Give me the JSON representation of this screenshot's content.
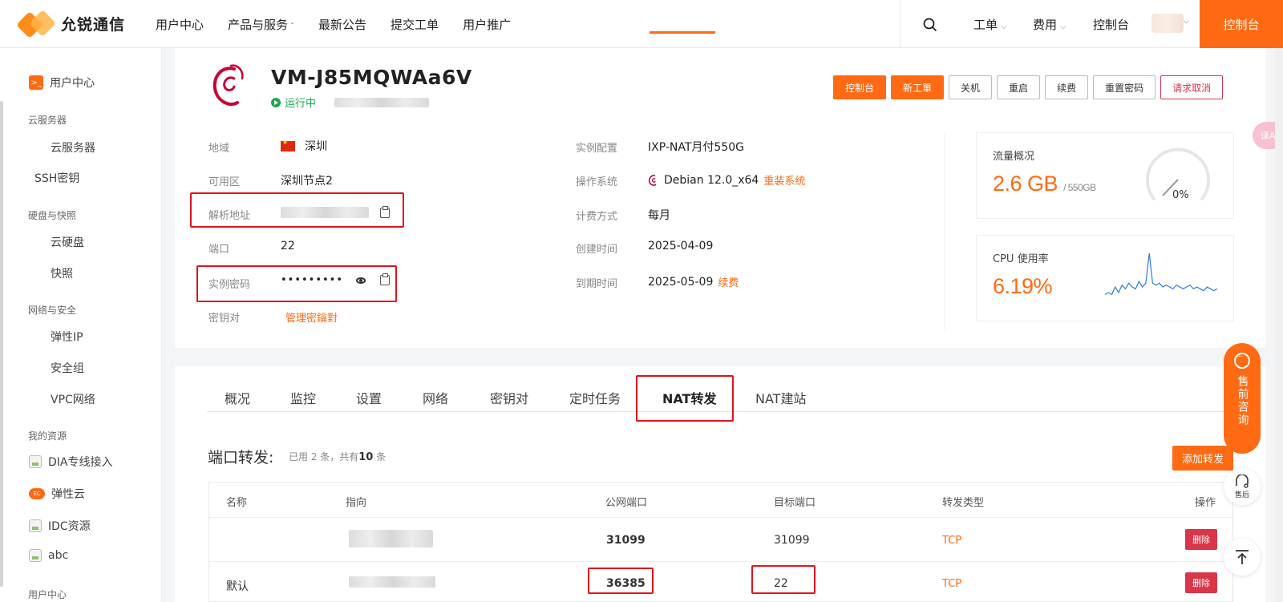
{
  "brand": {
    "name": "允锐通信"
  },
  "nav": [
    {
      "label": "用户中心"
    },
    {
      "label": "产品与服务",
      "caret": "ˇ"
    },
    {
      "label": "最新公告"
    },
    {
      "label": "提交工单"
    },
    {
      "label": "用户推广"
    }
  ],
  "header_right": {
    "ticket": "工单",
    "billing": "费用",
    "console_link": "控制台",
    "console_button": "控制台",
    "caret": "⌵"
  },
  "sidebar": {
    "user_center": "用户中心",
    "groups": [
      {
        "title": "云服务器",
        "items": [
          "云服务器",
          "SSH密钥"
        ]
      },
      {
        "title": "硬盘与快照",
        "items": [
          "云硬盘",
          "快照"
        ]
      },
      {
        "title": "网络与安全",
        "items": [
          "弹性IP",
          "安全组",
          "VPC网络"
        ]
      },
      {
        "title": "我的资源",
        "items": [
          "DIA专线接入",
          "弹性云",
          "IDC资源",
          "abc"
        ]
      },
      {
        "title": "用户中心",
        "items": []
      }
    ]
  },
  "instance": {
    "name": "VM-J85MQWAa6V",
    "status": "运行中",
    "actions": [
      "控制台",
      "新工單",
      "关机",
      "重启",
      "续费",
      "重置密码",
      "请求取消"
    ]
  },
  "info_left": [
    {
      "label": "地域",
      "value": "深圳"
    },
    {
      "label": "可用区",
      "value": "深圳节点2"
    },
    {
      "label": "解析地址",
      "value": ""
    },
    {
      "label": "端口",
      "value": "22"
    },
    {
      "label": "实例密码",
      "value": "•••••••••"
    },
    {
      "label": "密钥对",
      "value": "管理密鑰對"
    }
  ],
  "info_right": [
    {
      "label": "实例配置",
      "value": "IXP-NAT月付550G"
    },
    {
      "label": "操作系统",
      "value": "Debian 12.0_x64",
      "link": "重装系统"
    },
    {
      "label": "计费方式",
      "value": "每月"
    },
    {
      "label": "创建时间",
      "value": "2025-04-09"
    },
    {
      "label": "到期时间",
      "value": "2025-05-09",
      "link": "续费"
    }
  ],
  "traffic": {
    "label": "流量概况",
    "value": "2.6 GB",
    "quota": "/ 550GB",
    "percent": "0%",
    "percent_num": 0
  },
  "cpu": {
    "label": "CPU 使用率",
    "value": "6.19%",
    "spark": [
      2,
      3,
      2,
      6,
      3,
      7,
      5,
      8,
      6,
      5,
      9,
      6,
      8,
      24,
      8,
      7,
      8,
      6,
      7,
      6,
      5,
      7,
      6,
      5,
      6,
      7,
      5,
      6,
      5,
      4,
      6,
      5,
      4,
      5
    ]
  },
  "tabs": [
    "概况",
    "监控",
    "设置",
    "网络",
    "密钥对",
    "定时任务",
    "NAT转发",
    "NAT建站"
  ],
  "active_tab": "NAT转发",
  "forwarding": {
    "title": "端口转发:",
    "used_prefix": "已用 2 条，共有",
    "total": "10",
    "used_suffix": "条",
    "add_button": "添加转发",
    "columns": [
      "名称",
      "指向",
      "公网端口",
      "目标端口",
      "转发类型",
      "操作"
    ],
    "rows": [
      {
        "name": "",
        "public_port": "31099",
        "target_port": "31099",
        "type": "TCP",
        "action": "删除"
      },
      {
        "name": "默认",
        "public_port": "36385",
        "target_port": "22",
        "type": "TCP",
        "action": "删除"
      }
    ]
  },
  "float": {
    "consult": "售前咨询",
    "after_sales": "售后",
    "translate": "译A"
  },
  "colors": {
    "accent": "#ff6a13",
    "danger": "#d9364a",
    "success": "#19a94d",
    "highlight_box": "#e0141e"
  }
}
